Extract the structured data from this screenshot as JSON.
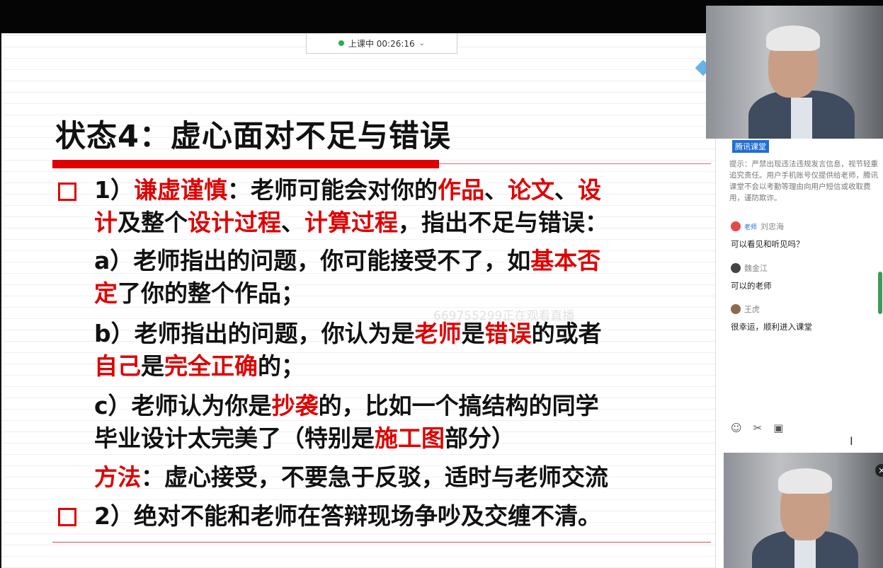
{
  "status": {
    "label": "上课中 00:26:16",
    "chevron": "chevron-down-icon"
  },
  "slide": {
    "title": "状态4：虚心面对不足与错误",
    "watermark": "669755299正在观看直播",
    "lines": [
      [
        "1）",
        "谦虚谨慎",
        "：老师可能会对你的",
        "作品",
        "、",
        "论文",
        "、",
        "设"
      ],
      [
        "计",
        "及整个",
        "设计过程",
        "、",
        "计算过程",
        "，指出不足与错误："
      ],
      [
        "a）老师指出的问题，你可能接受不了，如",
        "基本否"
      ],
      [
        "定",
        "了你的整个作品；"
      ],
      [
        "b）老师指出的问题，你认为是",
        "老师",
        "是",
        "错误",
        "的或者"
      ],
      [
        "自己",
        "是",
        "完全正确",
        "的；"
      ],
      [
        "c）老师认为你是",
        "抄袭",
        "的，比如一个搞结构的同学"
      ],
      [
        "毕业设计太完美了（特别是",
        "施工图",
        "部分）"
      ],
      [
        "方法",
        "：虚心接受，不要急于反驳，适时与老师交流"
      ],
      [
        "2）绝对不能和老师在答辩现场争吵及交缠不清。"
      ]
    ]
  },
  "panel": {
    "brand": "腾讯课堂",
    "notice": "提示：严禁出现违法违规发言信息，视节轻重追究责任。用户手机账号仅提供给老师，腾讯课堂不会以考勤等理由向用户短信或收取费用，谨防欺诈。",
    "messages": [
      {
        "name": "刘忠海",
        "tag": "老师",
        "text": "可以看见和听见吗？"
      },
      {
        "name": "魏金江",
        "tag": "",
        "text": "可以的老师"
      },
      {
        "name": "王虎",
        "tag": "",
        "text": "很幸运，顺利进入课堂"
      }
    ],
    "tools": [
      "emoji-icon",
      "scissors-icon",
      "image-icon"
    ]
  },
  "colors": {
    "accent_red": "#e00000",
    "status_green": "#22b14c",
    "brand_blue": "#1f6ed4"
  }
}
